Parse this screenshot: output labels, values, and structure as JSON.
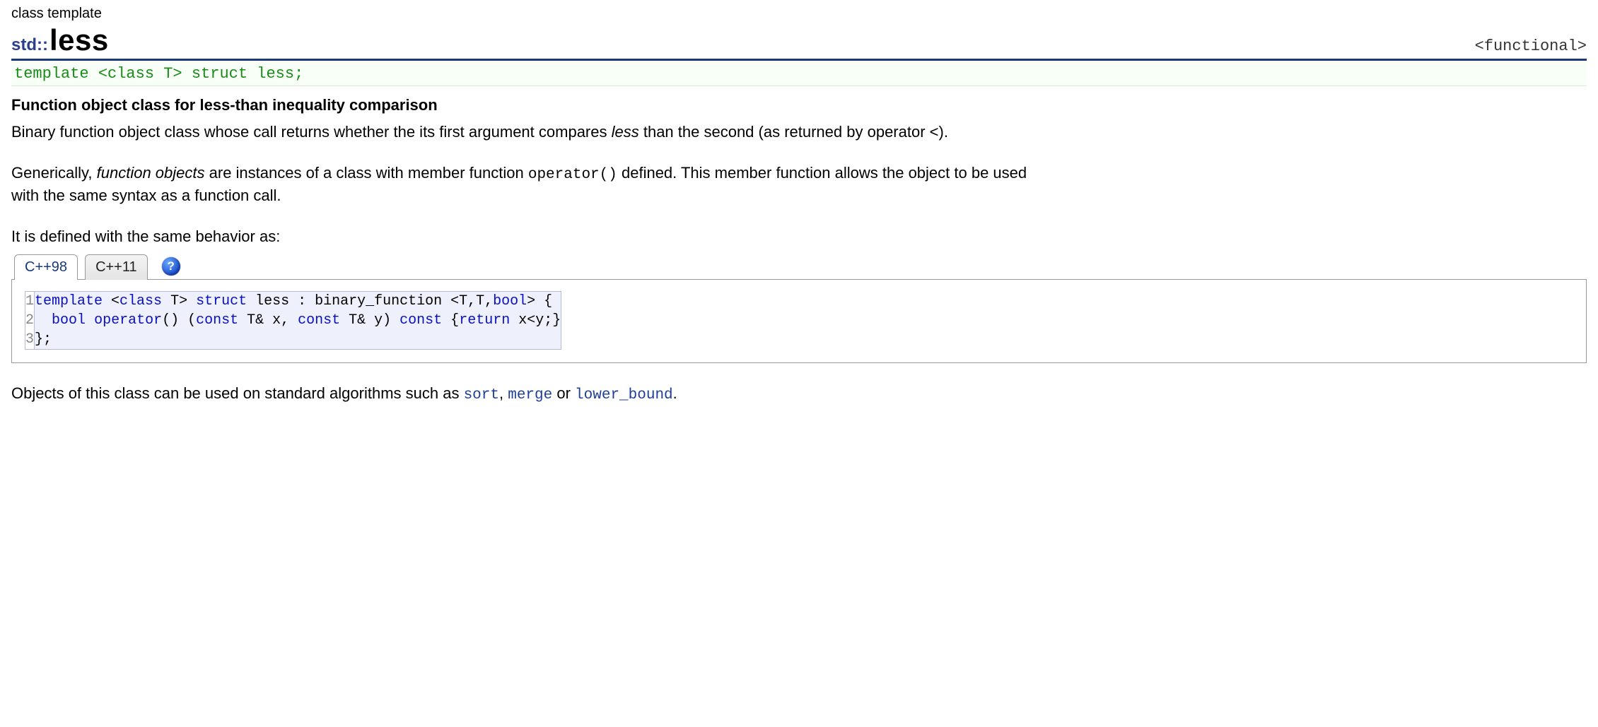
{
  "header": {
    "kind_label": "class template",
    "namespace": "std::",
    "name": "less",
    "header_hint": "<functional>"
  },
  "declaration": "template <class T> struct less;",
  "short_description": "Function object class for less-than inequality comparison",
  "para1": {
    "pre": "Binary function object class whose call returns whether the its first argument compares ",
    "em": "less",
    "post": " than the second (as returned by operator <)."
  },
  "para2": {
    "pre": "Generically, ",
    "em": "function objects",
    "mid": " are instances of a class with member function ",
    "code": "operator()",
    "post": " defined. This member function allows the object to be used with the same syntax as a function call."
  },
  "para3": "It is defined with the same behavior as:",
  "tabs": {
    "items": [
      "C++98",
      "C++11"
    ],
    "active_index": 0,
    "help_glyph": "?"
  },
  "code": {
    "line_numbers": "1\n2\n3",
    "tokens": [
      {
        "t": "template",
        "c": "kw"
      },
      {
        "t": " <",
        "c": "ident"
      },
      {
        "t": "class",
        "c": "kw"
      },
      {
        "t": " T> ",
        "c": "ident"
      },
      {
        "t": "struct",
        "c": "kw"
      },
      {
        "t": " less : binary_function <T,T,",
        "c": "ident"
      },
      {
        "t": "bool",
        "c": "kw"
      },
      {
        "t": "> {",
        "c": "ident"
      },
      {
        "t": "\n",
        "c": "ident"
      },
      {
        "t": "  ",
        "c": "ident"
      },
      {
        "t": "bool",
        "c": "kw"
      },
      {
        "t": " ",
        "c": "ident"
      },
      {
        "t": "operator",
        "c": "kw"
      },
      {
        "t": "() (",
        "c": "ident"
      },
      {
        "t": "const",
        "c": "kw"
      },
      {
        "t": " T& x, ",
        "c": "ident"
      },
      {
        "t": "const",
        "c": "kw"
      },
      {
        "t": " T& y) ",
        "c": "ident"
      },
      {
        "t": "const",
        "c": "kw"
      },
      {
        "t": " {",
        "c": "ident"
      },
      {
        "t": "return",
        "c": "kw"
      },
      {
        "t": " x<y;}",
        "c": "ident"
      },
      {
        "t": "\n",
        "c": "ident"
      },
      {
        "t": "};",
        "c": "ident"
      }
    ]
  },
  "footer": {
    "pre": "Objects of this class can be used on standard algorithms such as ",
    "links": [
      "sort",
      "merge",
      "lower_bound"
    ],
    "sep1": ", ",
    "sep2": " or ",
    "post": "."
  }
}
